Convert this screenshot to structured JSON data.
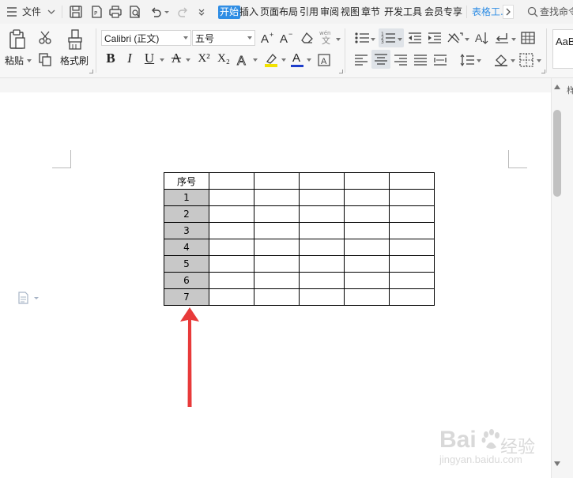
{
  "menubar": {
    "file_label": "文件",
    "tabs": [
      {
        "label": "开始",
        "active": true
      },
      {
        "label": "插入"
      },
      {
        "label": "页面布局"
      },
      {
        "label": "引用"
      },
      {
        "label": "审阅"
      },
      {
        "label": "视图"
      },
      {
        "label": "章节"
      },
      {
        "label": "开发工具"
      },
      {
        "label": "会员专享"
      },
      {
        "label": "表格工..."
      }
    ],
    "search_label": "查找命令"
  },
  "ribbon": {
    "paste_label": "粘贴",
    "format_painter_label": "格式刷",
    "font_name": "Calibri (正文)",
    "font_size": "五号",
    "bold": "B",
    "italic": "I",
    "underline": "U",
    "strikethrough": "A",
    "superscript": "X²",
    "subscript": "X₂",
    "font_color_letter": "A",
    "style_preview": "AaB",
    "accent_color": "#2f8de4",
    "font_color": "#1e3ecb",
    "highlight_color": "#f2e200"
  },
  "table": {
    "header": "序号",
    "rows": [
      "1",
      "2",
      "3",
      "4",
      "5",
      "6",
      "7"
    ],
    "shade_color": "#c8c8c8"
  },
  "annotation": {
    "arrow_color": "#e83a3a"
  },
  "watermark": {
    "brand": "Bai",
    "brand2": "du",
    "jingyan": "经验",
    "url": "jingyan.baidu.com"
  },
  "right_panel_char": "样"
}
